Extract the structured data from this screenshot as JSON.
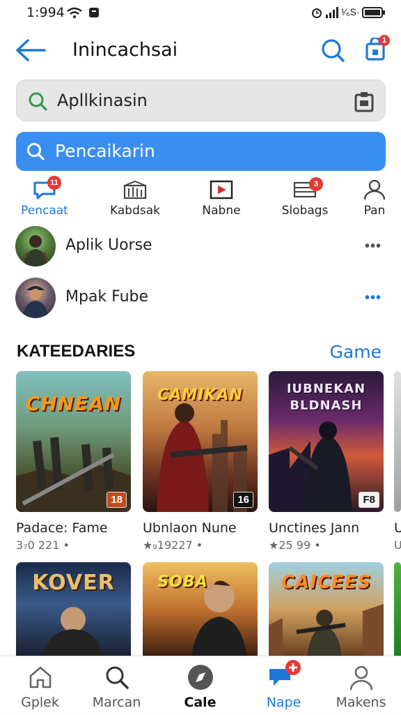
{
  "status": {
    "time": "1:994",
    "right_text": "𝄐 ıııl ¹⁄₆S·"
  },
  "header": {
    "title": "Inincachsai",
    "back_icon": "arrow-left-icon",
    "search_icon": "search-icon",
    "bag_icon": "shopping-bag-icon",
    "bag_badge": "1"
  },
  "search": {
    "value": "Apllkinasin"
  },
  "primary_button": {
    "label": "Pencaikarin"
  },
  "tabs": [
    {
      "label": "Pencaat",
      "icon": "chat-icon",
      "badge": "11",
      "active": true
    },
    {
      "label": "Kabdsak",
      "icon": "library-icon"
    },
    {
      "label": "Nabne",
      "icon": "video-icon"
    },
    {
      "label": "Slobags",
      "icon": "list-icon",
      "badge": "3"
    },
    {
      "label": "Pan",
      "icon": "person-icon"
    }
  ],
  "users": [
    {
      "name": "Aplik Uorse",
      "more": "•••"
    },
    {
      "name": "Mpak Fube",
      "more": "•••"
    }
  ],
  "categories": {
    "heading": "KATEEDARIES",
    "link": "Game",
    "cards": [
      {
        "logo": "CHNEAN",
        "age": "18",
        "title": "Padace: Fame",
        "stats": "3₇0 221 •"
      },
      {
        "logo": "CAMIKAN",
        "age": "16",
        "title": "Ubnlaon Nune",
        "stats": "★₉19227 •"
      },
      {
        "logo": "IUBNEKAN BLDNASH",
        "age": "F8",
        "title": "Unctines Jann",
        "stats": "★25 99 •"
      },
      {
        "logo": "",
        "age": "",
        "title": "U",
        "stats": "U"
      }
    ],
    "row2": [
      {
        "logo": "KOVER"
      },
      {
        "logo": "SOBA"
      },
      {
        "logo": "CAICEES"
      }
    ]
  },
  "bottom_nav": [
    {
      "label": "Gplek",
      "icon": "home-icon"
    },
    {
      "label": "Marcan",
      "icon": "search-icon"
    },
    {
      "label": "Cale",
      "icon": "compass-icon",
      "bold": true
    },
    {
      "label": "Nape",
      "icon": "chat-plus-icon",
      "active": true
    },
    {
      "label": "Makens",
      "icon": "person-icon"
    }
  ],
  "colors": {
    "accent": "#1e78d6",
    "button": "#3a8ef0",
    "badge": "#e53935"
  }
}
